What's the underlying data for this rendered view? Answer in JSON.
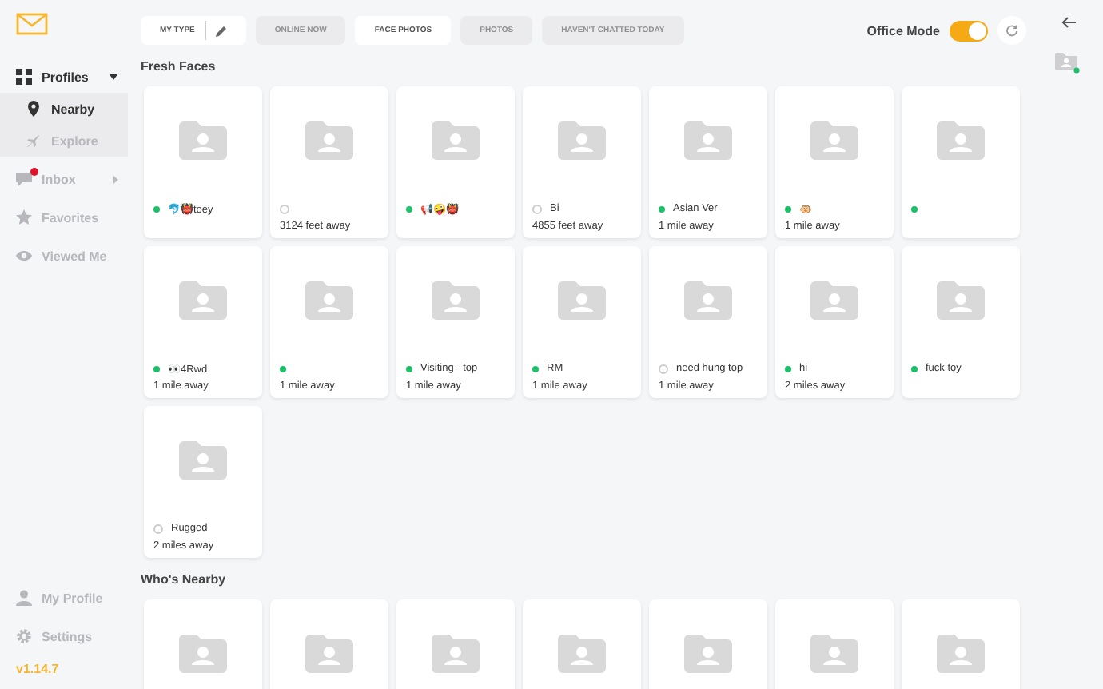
{
  "sidebar": {
    "items": [
      {
        "label": "Profiles",
        "kind": "group",
        "expanded": true,
        "children": [
          {
            "label": "Nearby",
            "selected": true
          },
          {
            "label": "Explore",
            "selected": false
          }
        ]
      },
      {
        "label": "Inbox",
        "kind": "submenu",
        "badge": true,
        "selected": false
      },
      {
        "label": "Favorites",
        "kind": "plain",
        "selected": false
      },
      {
        "label": "Viewed Me",
        "kind": "plain",
        "selected": false
      }
    ],
    "bottom": [
      {
        "label": "My Profile",
        "kind": "profile"
      },
      {
        "label": "Settings",
        "kind": "settings"
      }
    ],
    "version": "v1.14.7"
  },
  "filters": [
    {
      "label": "MY TYPE",
      "selected": true,
      "editable": true
    },
    {
      "label": "ONLINE NOW",
      "selected": false,
      "editable": false
    },
    {
      "label": "FACE PHOTOS",
      "selected": true,
      "editable": false
    },
    {
      "label": "PHOTOS",
      "selected": false,
      "editable": false
    },
    {
      "label": "HAVEN'T CHATTED TODAY",
      "selected": false,
      "editable": false
    }
  ],
  "office_mode": {
    "label": "Office Mode",
    "on": true
  },
  "sections": [
    {
      "title": "Fresh Faces",
      "profiles": [
        {
          "kind": "profile",
          "name": "🐬👹toey",
          "online": true
        },
        {
          "kind": "profile",
          "distance": "3124 feet away",
          "online": false
        },
        {
          "kind": "profile",
          "name": "📢🤪👹",
          "online": true
        },
        {
          "kind": "profile",
          "name": "Bi",
          "distance": "4855 feet away",
          "online": false
        },
        {
          "kind": "profile",
          "name": "Asian Ver",
          "distance": "1 mile away",
          "online": true
        },
        {
          "kind": "profile",
          "name": "🐵",
          "distance": "1 mile away",
          "online": true
        },
        {
          "kind": "profile",
          "online": true
        },
        {
          "kind": "profile",
          "name": "👀4Rwd",
          "distance": "1 mile away",
          "online": true
        },
        {
          "kind": "profile",
          "distance": "1 mile away",
          "online": true
        },
        {
          "kind": "profile",
          "name": "Visiting - top",
          "distance": "1 mile away",
          "online": true
        },
        {
          "kind": "profile",
          "name": "RM",
          "distance": "1 mile away",
          "online": true
        },
        {
          "kind": "profile",
          "name": "need hung top",
          "distance": "1 mile away",
          "online": false
        },
        {
          "kind": "profile",
          "name": "hi",
          "distance": "2 miles away",
          "online": true
        },
        {
          "kind": "profile",
          "name": "fuck toy",
          "online": true
        },
        {
          "kind": "profile",
          "name": "Rugged",
          "distance": "2 miles away",
          "online": false
        }
      ]
    },
    {
      "title": "Who's Nearby",
      "profiles": [
        {
          "kind": "placeholder"
        },
        {
          "kind": "placeholder"
        },
        {
          "kind": "placeholder"
        },
        {
          "kind": "placeholder"
        },
        {
          "kind": "placeholder"
        },
        {
          "kind": "placeholder"
        },
        {
          "kind": "placeholder"
        }
      ]
    }
  ]
}
